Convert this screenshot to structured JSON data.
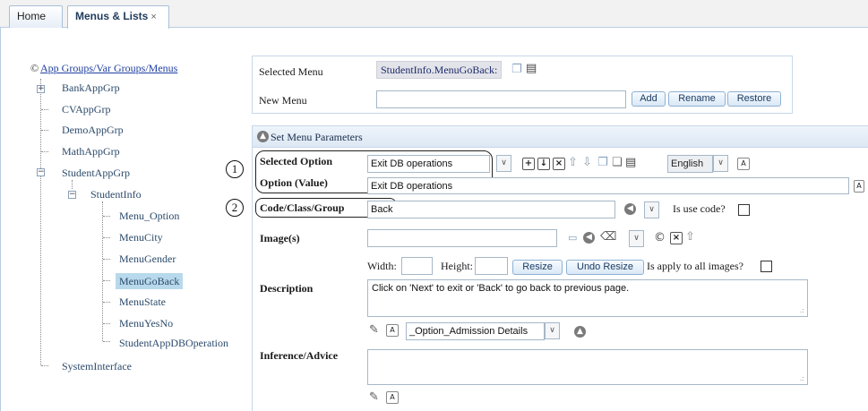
{
  "tabs": [
    {
      "label": "Home"
    },
    {
      "label": "Menus & Lists",
      "close": "×"
    }
  ],
  "tree": {
    "root": "App Groups/Var Groups/Menus",
    "root_icon": "©",
    "groups": [
      "BankAppGrp",
      "CVAppGrp",
      "DemoAppGrp",
      "MathAppGrp",
      "StudentAppGrp"
    ],
    "student_child": "StudentInfo",
    "menus": [
      "Menu_Option",
      "MenuCity",
      "MenuGender",
      "MenuGoBack",
      "MenuState",
      "MenuYesNo",
      "StudentAppDBOperation"
    ],
    "last": "SystemInterface",
    "selected": "MenuGoBack"
  },
  "menu_panel": {
    "selected_menu_label": "Selected Menu",
    "selected_menu_value": "StudentInfo.MenuGoBack:",
    "new_menu_label": "New Menu",
    "new_menu_value": "",
    "add_label": "Add",
    "rename_label": "Rename",
    "restore_label": "Restore"
  },
  "params": {
    "header": "Set Menu Parameters",
    "selected_option_label": "Selected Option",
    "selected_option_value": "Exit DB operations",
    "language": "English",
    "option_value_label": "Option (Value)",
    "option_value_value": "Exit DB operations",
    "code_label": "Code/Class/Group",
    "code_value": "Back",
    "is_use_code_label": "Is use code?",
    "images_label": "Image(s)",
    "width_label": "Width:",
    "height_label": "Height:",
    "resize_label": "Resize",
    "undo_resize_label": "Undo Resize",
    "apply_all_label": "Is apply to all images?",
    "description_label": "Description",
    "description_value": "Click on 'Next' to exit or 'Back' to go back to previous page.",
    "template_value": "_Option_Admission Details",
    "inference_label": "Inference/Advice",
    "inference_value": ""
  },
  "markers": [
    "1",
    "2"
  ]
}
